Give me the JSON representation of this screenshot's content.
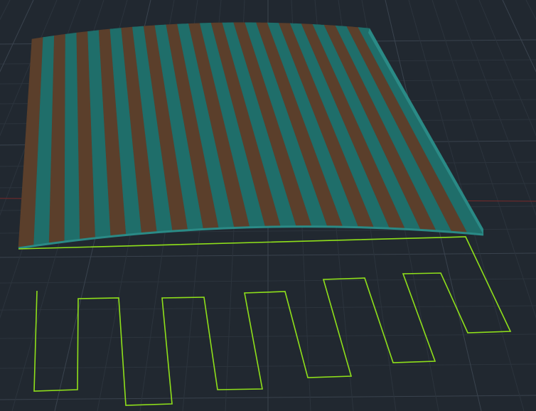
{
  "viewport": {
    "background": "#212830",
    "grid": {
      "visible": true,
      "minor_color": "#2c343d",
      "major_color": "#3a434e"
    },
    "x_axis_color": "#7a2a2a"
  },
  "surface": {
    "stripe_colors": [
      "#5b3f2b",
      "#1f6e6a"
    ],
    "stripe_count": 30,
    "edge_color": "#2a8a86"
  },
  "profile_curve": {
    "color": "#8fe01a"
  }
}
